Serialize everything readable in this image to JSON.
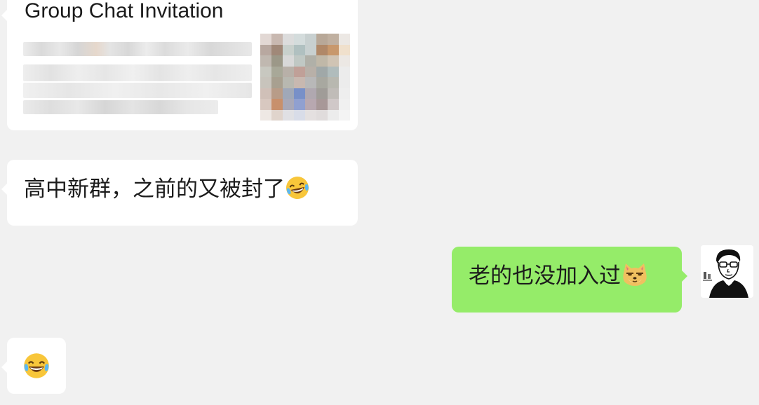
{
  "messages": {
    "invite_card": {
      "title": "Group Chat Invitation"
    },
    "incoming_text": {
      "text": "高中新群，之前的又被封了",
      "emoji": "face-with-tears-of-joy-icon"
    },
    "outgoing_text": {
      "text": "老的也没加入过",
      "emoji": "doge-icon"
    },
    "incoming_emoji": {
      "emoji": "face-with-tears-of-joy-icon"
    }
  },
  "colors": {
    "background": "#f1f1f1",
    "incoming_bubble": "#ffffff",
    "outgoing_bubble": "#95ec69"
  }
}
